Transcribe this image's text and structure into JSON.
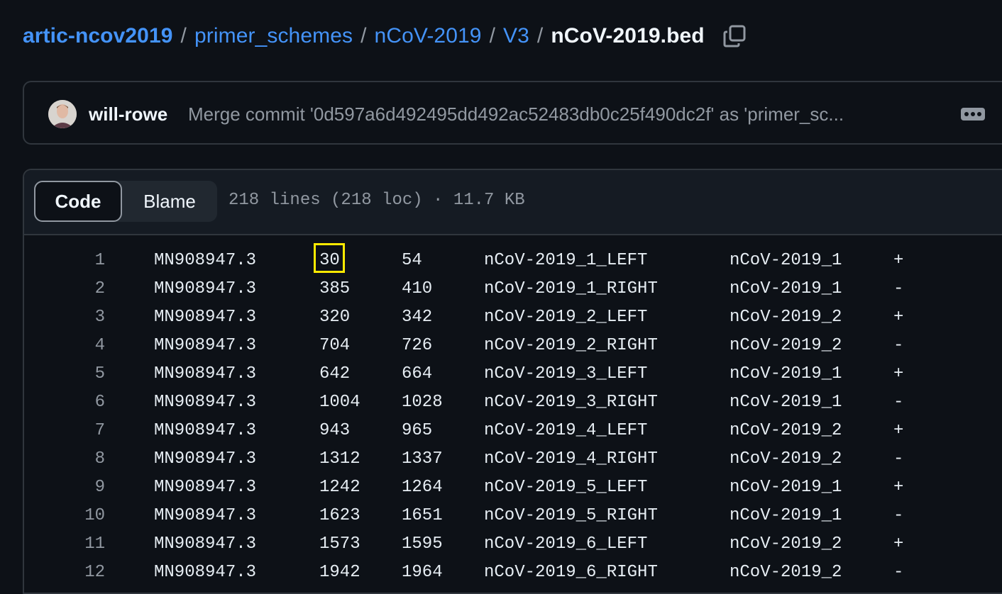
{
  "breadcrumb": {
    "repo": "artic-ncov2019",
    "dir1": "primer_schemes",
    "dir2": "nCoV-2019",
    "dir3": "V3",
    "file": "nCoV-2019.bed",
    "separator": "/"
  },
  "commit": {
    "author": "will-rowe",
    "message": "Merge commit '0d597a6d492495dd492ac52483db0c25f490dc2f' as 'primer_sc..."
  },
  "file_header": {
    "tabs": [
      "Code",
      "Blame"
    ],
    "active_tab": "Code",
    "meta": "218 lines (218 loc) · 11.7 KB"
  },
  "rows": [
    [
      "1",
      "MN908947.3",
      "30",
      "54",
      "nCoV-2019_1_LEFT",
      "nCoV-2019_1",
      "+"
    ],
    [
      "2",
      "MN908947.3",
      "385",
      "410",
      "nCoV-2019_1_RIGHT",
      "nCoV-2019_1",
      "-"
    ],
    [
      "3",
      "MN908947.3",
      "320",
      "342",
      "nCoV-2019_2_LEFT",
      "nCoV-2019_2",
      "+"
    ],
    [
      "4",
      "MN908947.3",
      "704",
      "726",
      "nCoV-2019_2_RIGHT",
      "nCoV-2019_2",
      "-"
    ],
    [
      "5",
      "MN908947.3",
      "642",
      "664",
      "nCoV-2019_3_LEFT",
      "nCoV-2019_1",
      "+"
    ],
    [
      "6",
      "MN908947.3",
      "1004",
      "1028",
      "nCoV-2019_3_RIGHT",
      "nCoV-2019_1",
      "-"
    ],
    [
      "7",
      "MN908947.3",
      "943",
      "965",
      "nCoV-2019_4_LEFT",
      "nCoV-2019_2",
      "+"
    ],
    [
      "8",
      "MN908947.3",
      "1312",
      "1337",
      "nCoV-2019_4_RIGHT",
      "nCoV-2019_2",
      "-"
    ],
    [
      "9",
      "MN908947.3",
      "1242",
      "1264",
      "nCoV-2019_5_LEFT",
      "nCoV-2019_1",
      "+"
    ],
    [
      "10",
      "MN908947.3",
      "1623",
      "1651",
      "nCoV-2019_5_RIGHT",
      "nCoV-2019_1",
      "-"
    ],
    [
      "11",
      "MN908947.3",
      "1573",
      "1595",
      "nCoV-2019_6_LEFT",
      "nCoV-2019_2",
      "+"
    ],
    [
      "12",
      "MN908947.3",
      "1942",
      "1964",
      "nCoV-2019_6_RIGHT",
      "nCoV-2019_2",
      "-"
    ]
  ],
  "highlighted_cell": {
    "row": 0,
    "col": 2,
    "color": "#ffea00"
  },
  "colors": {
    "background": "#0d1117",
    "link": "#4493f8",
    "muted": "#9198a1",
    "border": "#30363d"
  },
  "icons": {
    "copy": "copy-icon",
    "more": "kebab-horizontal-icon",
    "avatar": "avatar"
  }
}
